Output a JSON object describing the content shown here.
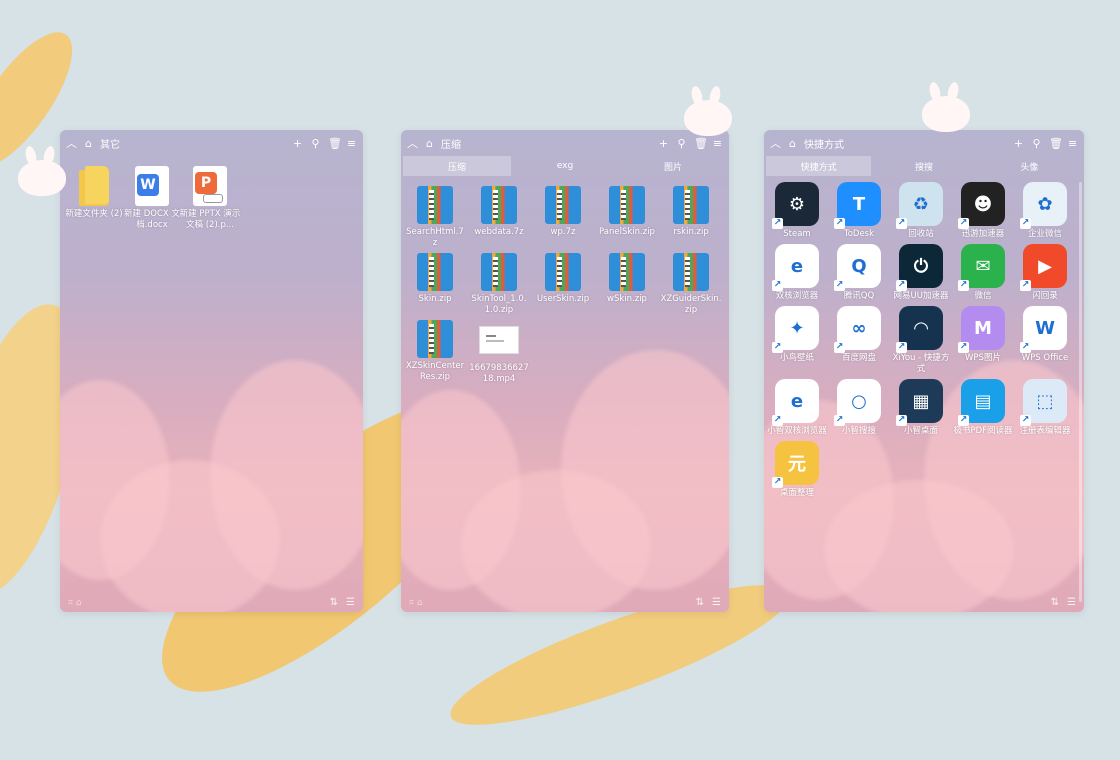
{
  "panels": [
    {
      "title": "其它",
      "files": [
        {
          "label": "新建文件夹 (2)",
          "icon": "folder-icon"
        },
        {
          "label": "新建 DOCX 文档.docx",
          "icon": "docx-icon"
        },
        {
          "label": "新建 PPTX 演示文稿 (2).p...",
          "icon": "pptx-icon"
        }
      ]
    },
    {
      "title": "压缩",
      "tabs": [
        "压缩",
        "exg",
        "图片"
      ],
      "files": [
        {
          "label": "SearchHtml.7z",
          "icon": "archive-icon"
        },
        {
          "label": "webdata.7z",
          "icon": "archive-icon"
        },
        {
          "label": "wp.7z",
          "icon": "archive-icon"
        },
        {
          "label": "PanelSkin.zip",
          "icon": "archive-icon"
        },
        {
          "label": "rskin.zip",
          "icon": "archive-icon"
        },
        {
          "label": "Skin.zip",
          "icon": "archive-icon"
        },
        {
          "label": "SkinTool_1.0.1.0.zip",
          "icon": "archive-icon"
        },
        {
          "label": "UserSkin.zip",
          "icon": "archive-icon"
        },
        {
          "label": "wSkin.zip",
          "icon": "archive-icon"
        },
        {
          "label": "XZGuiderSkin.zip",
          "icon": "archive-icon"
        },
        {
          "label": "XZSkinCenterRes.zip",
          "icon": "archive-icon"
        },
        {
          "label": "1667983662718.mp4",
          "icon": "video-thumb-icon"
        }
      ]
    },
    {
      "title": "快捷方式",
      "tabs": [
        "快捷方式",
        "搜搜",
        "头像"
      ],
      "apps": [
        {
          "label": "Steam",
          "icon": "steam-icon",
          "color": "#1b2838",
          "glyph": "⚙"
        },
        {
          "label": "ToDesk",
          "icon": "todesk-icon",
          "color": "#1f8fff",
          "glyph": "T"
        },
        {
          "label": "回收站",
          "icon": "recycle-bin-icon",
          "color": "#cfe3ee",
          "glyph": "♻"
        },
        {
          "label": "迅游加速器",
          "icon": "xunyou-icon",
          "color": "#222222",
          "glyph": "☻"
        },
        {
          "label": "企业微信",
          "icon": "wecom-icon",
          "color": "#e8f1f8",
          "glyph": "✿"
        },
        {
          "label": "双核浏览器",
          "icon": "browser-icon",
          "color": "#ffffff",
          "glyph": "e"
        },
        {
          "label": "腾讯QQ",
          "icon": "qq-icon",
          "color": "#ffffff",
          "glyph": "Q"
        },
        {
          "label": "网易UU加速器",
          "icon": "uu-icon",
          "color": "#0c2838",
          "glyph": "⏻"
        },
        {
          "label": "微信",
          "icon": "wechat-icon",
          "color": "#2bb24c",
          "glyph": "✉"
        },
        {
          "label": "闪回录",
          "icon": "flashback-icon",
          "color": "#f04a2a",
          "glyph": "▶"
        },
        {
          "label": "小鸟壁纸",
          "icon": "bird-wallpaper-icon",
          "color": "#ffffff",
          "glyph": "✦"
        },
        {
          "label": "百度网盘",
          "icon": "baidu-netdisk-icon",
          "color": "#ffffff",
          "glyph": "∞"
        },
        {
          "label": "XiYou - 快捷方式",
          "icon": "xiyou-icon",
          "color": "#15324f",
          "glyph": "◠"
        },
        {
          "label": "WPS图片",
          "icon": "wps-picture-icon",
          "color": "#b48cf0",
          "glyph": "M"
        },
        {
          "label": "WPS Office",
          "icon": "wps-office-icon",
          "color": "#ffffff",
          "glyph": "W"
        },
        {
          "label": "小智双核浏览器",
          "icon": "xiaozhi-browser-icon",
          "color": "#ffffff",
          "glyph": "e"
        },
        {
          "label": "小智搜搜",
          "icon": "xiaozhi-search-icon",
          "color": "#ffffff",
          "glyph": "○"
        },
        {
          "label": "小智桌面",
          "icon": "xiaozhi-desktop-icon",
          "color": "#1d3b58",
          "glyph": "▦"
        },
        {
          "label": "极书PDF阅读器",
          "icon": "pdf-reader-icon",
          "color": "#1aa0e8",
          "glyph": "▤"
        },
        {
          "label": "注册表编辑器",
          "icon": "regedit-icon",
          "color": "#dbeaf6",
          "glyph": "⬚"
        },
        {
          "label": "桌面整理",
          "icon": "desktop-organize-icon",
          "color": "#f6c341",
          "glyph": "元"
        }
      ]
    }
  ],
  "colors": {
    "panel_tab_active": "rgba(255,255,255,.28)",
    "background": "#d6e2e6"
  }
}
